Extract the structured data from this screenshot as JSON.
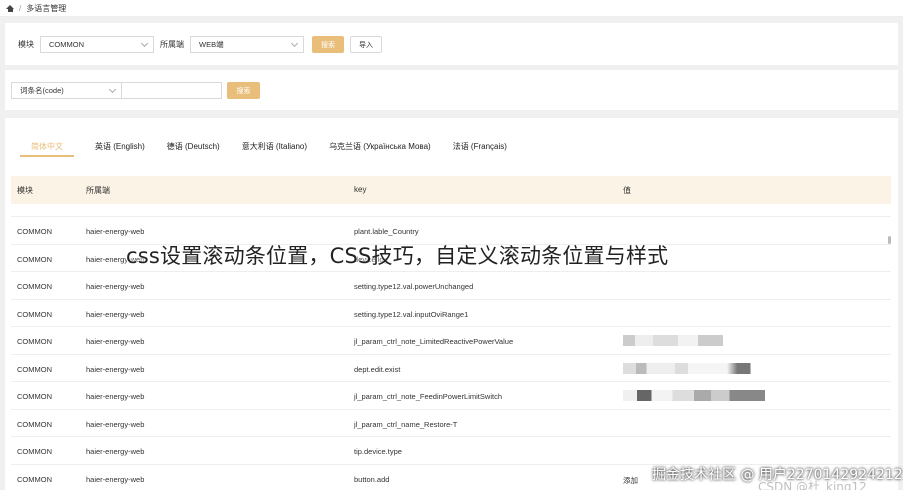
{
  "breadcrumb": {
    "separator": "/",
    "current": "多语言管理"
  },
  "filters": {
    "module_label": "模块",
    "module_value": "COMMON",
    "platform_label": "所属端",
    "platform_value": "WEB端",
    "search_button": "搜索",
    "import_button": "导入"
  },
  "search": {
    "field_select": "词条名(code)",
    "search_button": "搜索"
  },
  "tabs": [
    {
      "label": "简体中文"
    },
    {
      "label": "英语 (English)"
    },
    {
      "label": "德语 (Deutsch)"
    },
    {
      "label": "意大利语 (Italiano)"
    },
    {
      "label": "乌克兰语 (Українська Мова)"
    },
    {
      "label": "法语 (Français)"
    }
  ],
  "table": {
    "columns": [
      "模块",
      "所属端",
      "key",
      "值"
    ],
    "rows": [
      {
        "module": "COMMON",
        "platform": "haier-energy-web",
        "key": "plant.lable_Country",
        "value": ""
      },
      {
        "module": "COMMON",
        "platform": "haier-energy-web",
        "key": "device.log",
        "value": ""
      },
      {
        "module": "COMMON",
        "platform": "haier-energy-web",
        "key": "setting.type12.val.powerUnchanged",
        "value": ""
      },
      {
        "module": "COMMON",
        "platform": "haier-energy-web",
        "key": "setting.type12.val.inputOviRange1",
        "value": ""
      },
      {
        "module": "COMMON",
        "platform": "haier-energy-web",
        "key": "jl_param_ctrl_note_LimitedReactivePowerValue",
        "value": ""
      },
      {
        "module": "COMMON",
        "platform": "haier-energy-web",
        "key": "dept.edit.exist",
        "value": ""
      },
      {
        "module": "COMMON",
        "platform": "haier-energy-web",
        "key": "jl_param_ctrl_note_FeedinPowerLimitSwitch",
        "value": ""
      },
      {
        "module": "COMMON",
        "platform": "haier-energy-web",
        "key": "jl_param_ctrl_name_Restore-T",
        "value": ""
      },
      {
        "module": "COMMON",
        "platform": "haier-energy-web",
        "key": "tip.device.type",
        "value": ""
      },
      {
        "module": "COMMON",
        "platform": "haier-energy-web",
        "key": "button.add",
        "value": "添加"
      }
    ]
  },
  "overlay": {
    "title": "css设置滚动条位置，CSS技巧，自定义滚动条位置与样式",
    "watermark": "掘金技术社区 @ 用户2270142924212",
    "watermark2": "CSDN @杜_king12"
  },
  "colors": {
    "accent": "#e9bd7a",
    "header_bg": "#fbf3e6",
    "page_bg": "#f0f0f0"
  }
}
